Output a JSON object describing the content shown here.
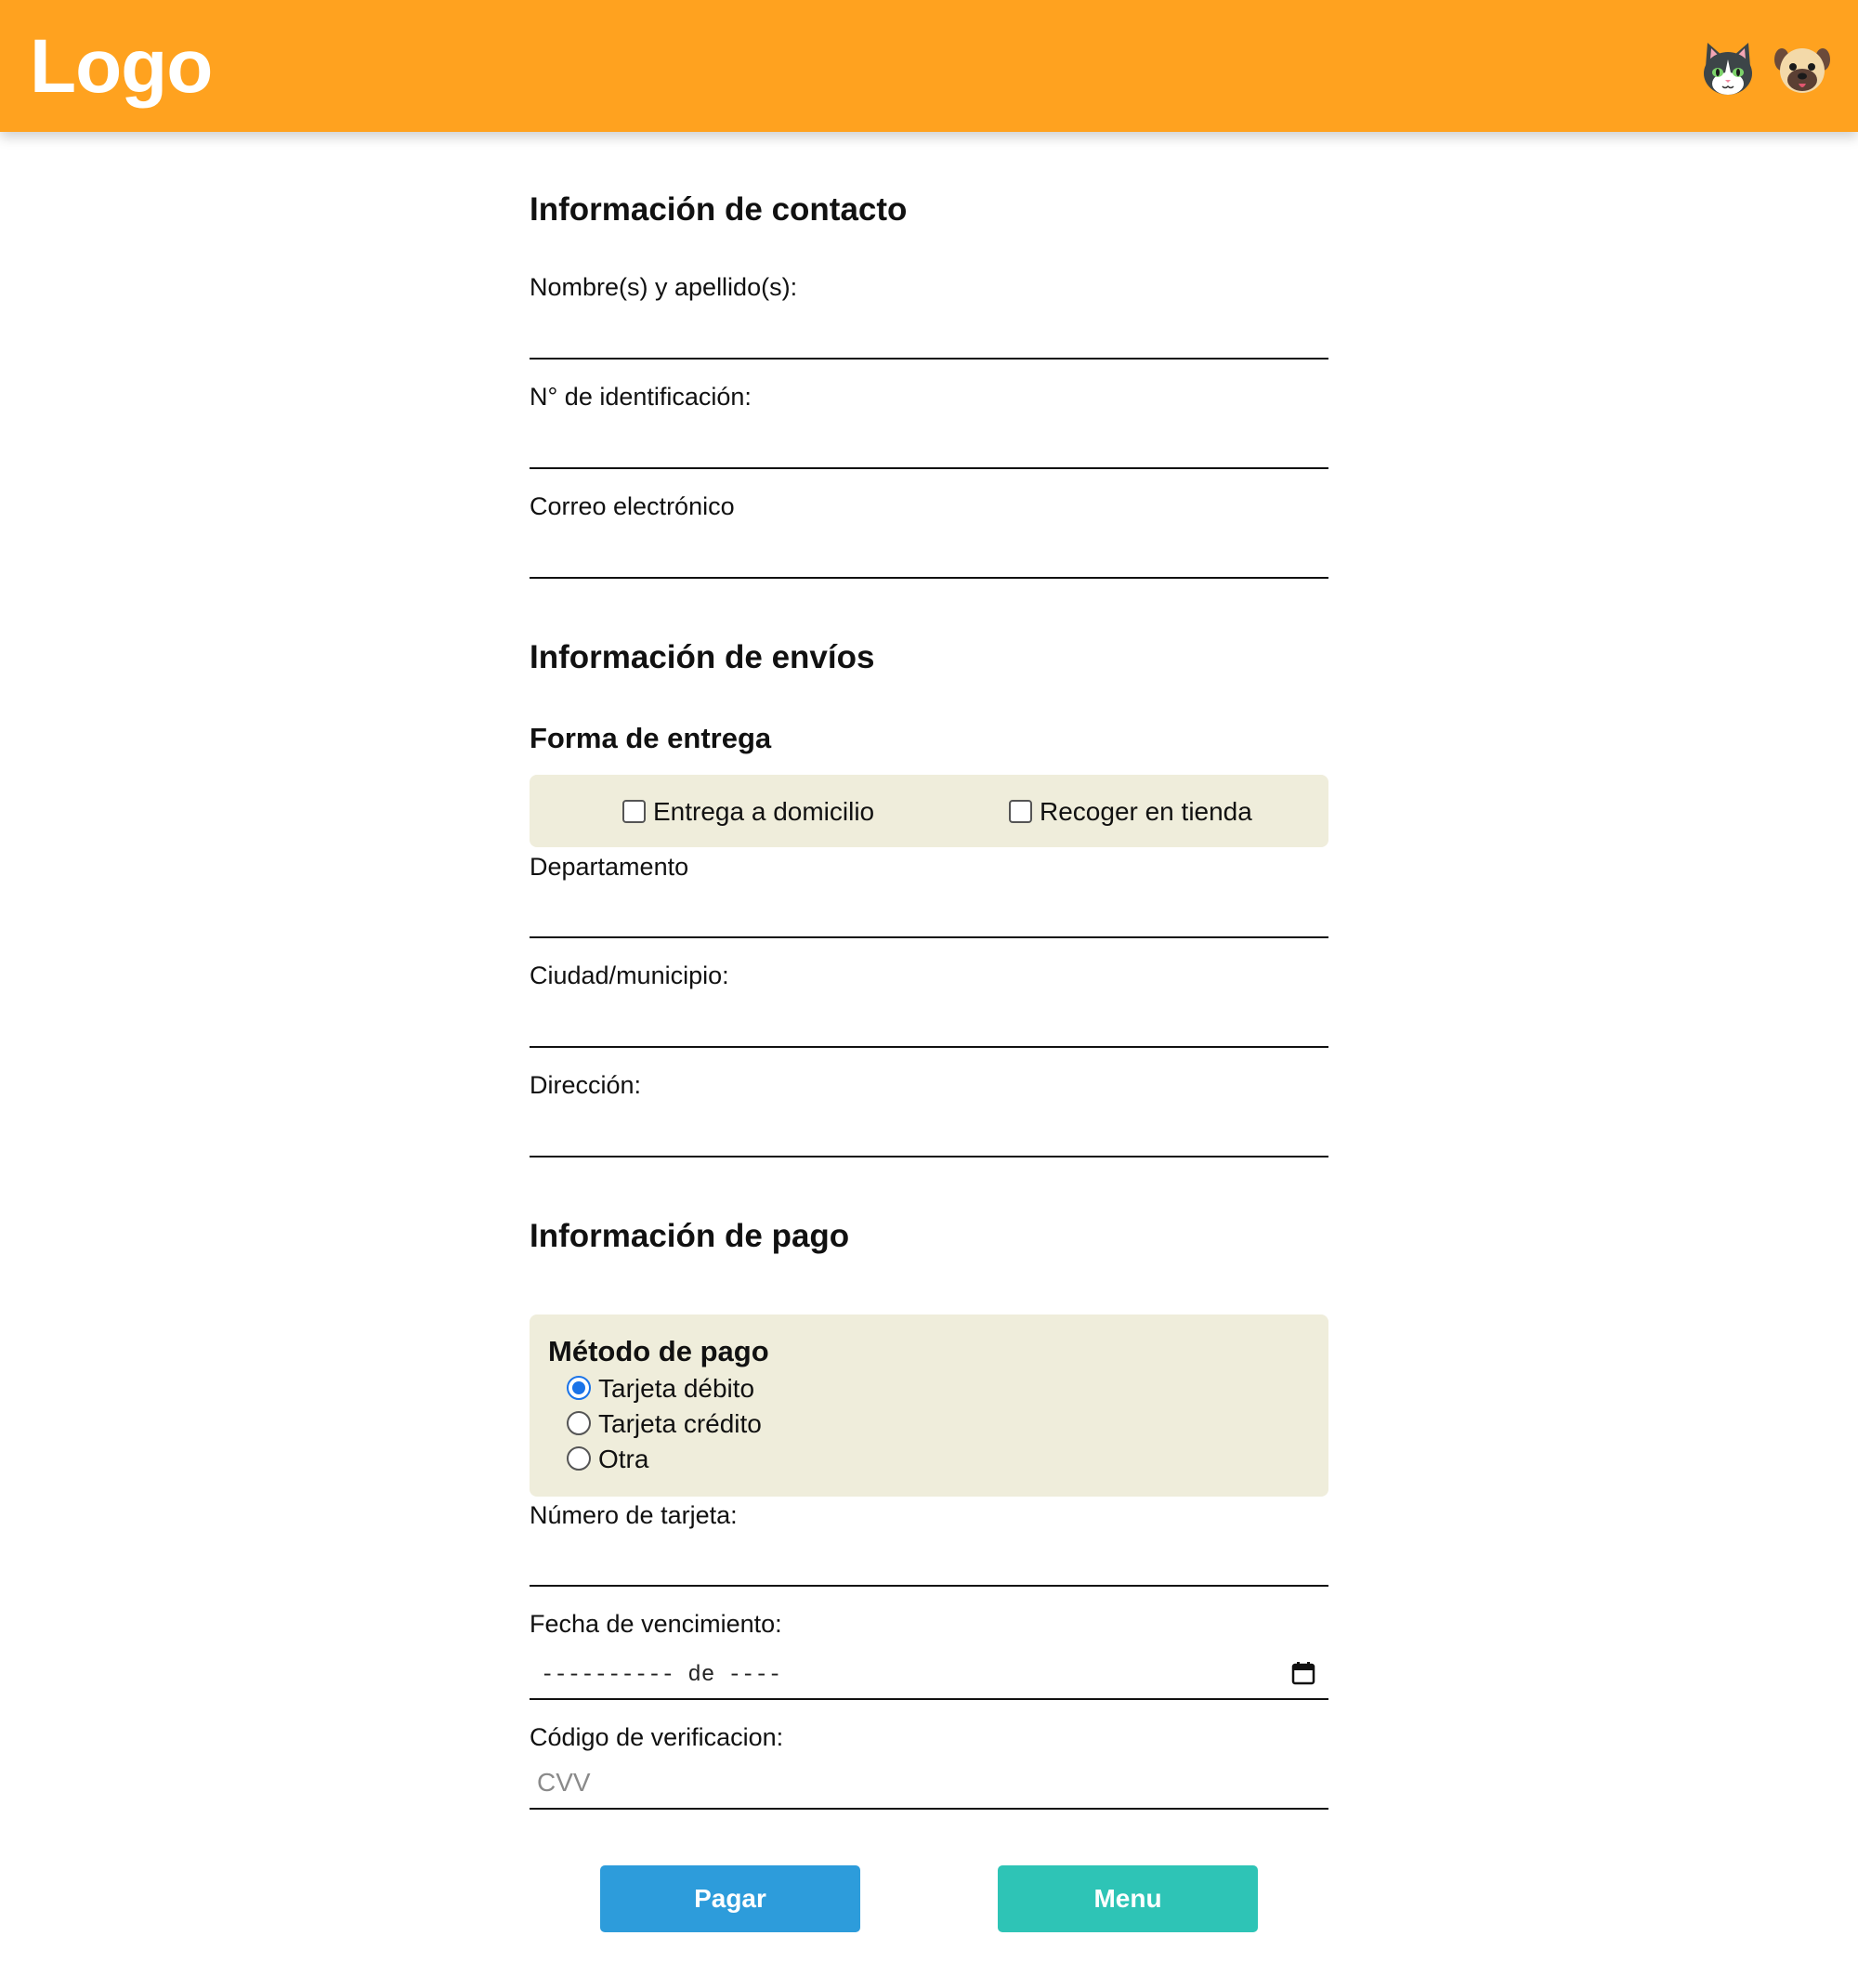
{
  "header": {
    "logo_text": "Logo",
    "icons": [
      "cat-face-icon",
      "dog-face-icon"
    ],
    "background_color": "#ffa21f"
  },
  "contact": {
    "title": "Información de contacto",
    "name_label": "Nombre(s) y apellido(s):",
    "name_value": "",
    "id_label": "N° de identificación:",
    "id_value": "",
    "email_label": "Correo electrónico",
    "email_value": ""
  },
  "shipping": {
    "title": "Información de envíos",
    "delivery_title": "Forma de entrega",
    "options": [
      {
        "label": "Entrega a domicilio",
        "checked": false
      },
      {
        "label": "Recoger en tienda",
        "checked": false
      }
    ],
    "department_label": "Departamento",
    "department_value": "",
    "city_label": "Ciudad/municipio:",
    "city_value": "",
    "address_label": "Dirección:",
    "address_value": ""
  },
  "payment": {
    "title": "Información de pago",
    "method_title": "Método de pago",
    "methods": [
      {
        "label": "Tarjeta débito",
        "checked": true
      },
      {
        "label": "Tarjeta crédito",
        "checked": false
      },
      {
        "label": "Otra",
        "checked": false
      }
    ],
    "card_label": "Número de tarjeta:",
    "card_value": "",
    "expiry_label": "Fecha de vencimiento:",
    "expiry_display": "---------- de ----",
    "cvv_label": "Código de verificacion:",
    "cvv_placeholder": "CVV"
  },
  "actions": {
    "pay_label": "Pagar",
    "menu_label": "Menu",
    "pay_color": "#2d9cdb",
    "menu_color": "#2ec4b6"
  },
  "panel_color": "#efeddb"
}
